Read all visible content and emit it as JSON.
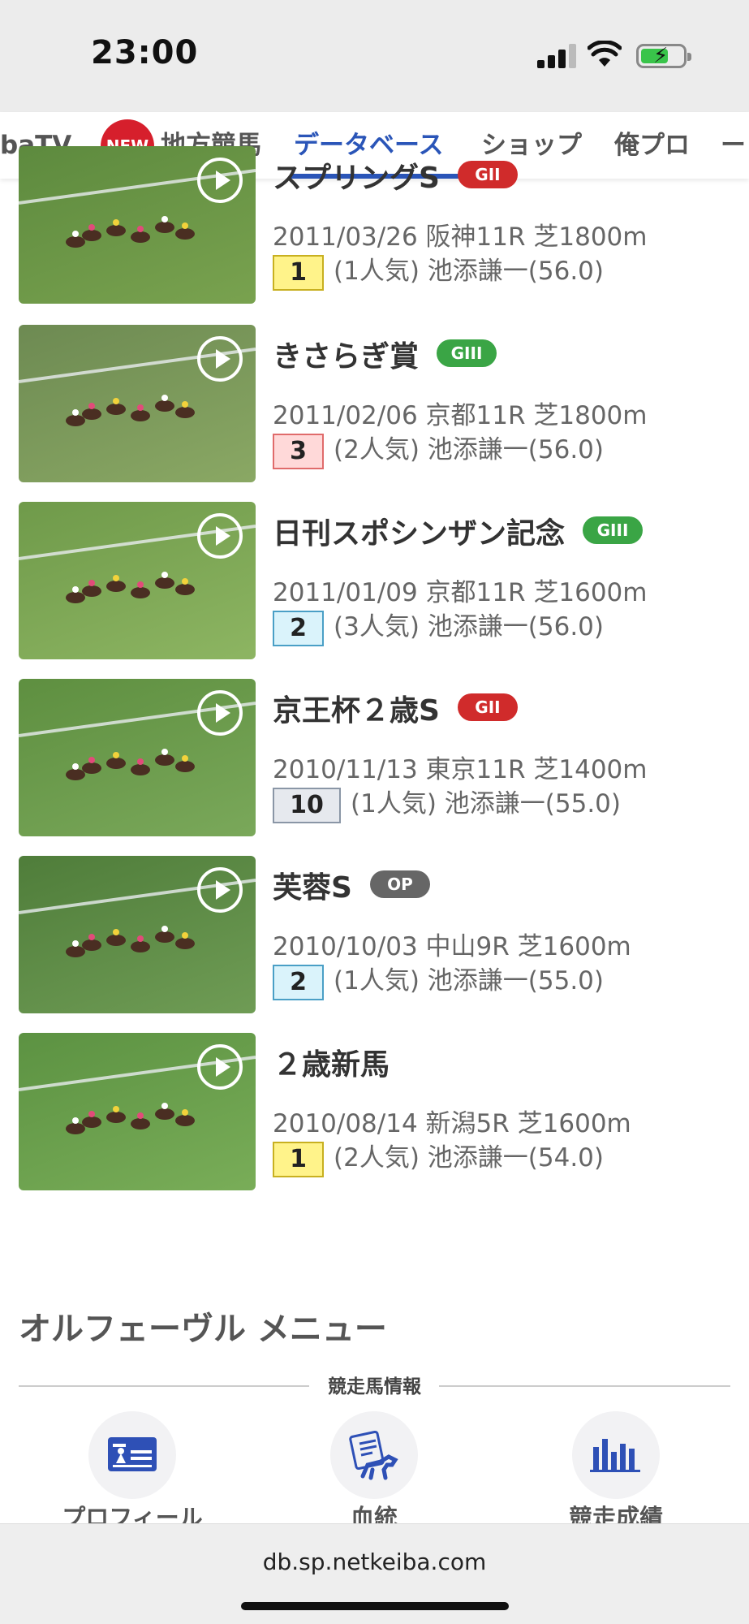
{
  "status_bar": {
    "time": "23:00"
  },
  "nav": {
    "tabs": [
      {
        "label": "baTV"
      },
      {
        "label": "地方競馬",
        "badge": "NEW"
      },
      {
        "label": "データベース",
        "active": true
      },
      {
        "label": "ショップ"
      },
      {
        "label": "俺プロ"
      },
      {
        "label": "ー"
      }
    ]
  },
  "races": [
    {
      "name": "スプリングS",
      "grade": "GII",
      "grade_color": "#d02b2b",
      "info": "2011/03/26 阪神11R 芝1800m",
      "rank": "1",
      "rank_bg": "#fff38a",
      "rank_border": "#c8b020",
      "popularity": "(1人気)",
      "jockey": "池添謙一(56.0)"
    },
    {
      "name": "きさらぎ賞",
      "grade": "GIII",
      "grade_color": "#3aa545",
      "info": "2011/02/06 京都11R 芝1800m",
      "rank": "3",
      "rank_bg": "#ffd9d9",
      "rank_border": "#e06b6b",
      "popularity": "(2人気)",
      "jockey": "池添謙一(56.0)"
    },
    {
      "name": "日刊スポシンザン記念",
      "grade": "GIII",
      "grade_color": "#3aa545",
      "info": "2011/01/09 京都11R 芝1600m",
      "rank": "2",
      "rank_bg": "#daf3fb",
      "rank_border": "#4a9fc6",
      "popularity": "(3人気)",
      "jockey": "池添謙一(56.0)"
    },
    {
      "name": "京王杯２歳S",
      "grade": "GII",
      "grade_color": "#d02b2b",
      "info": "2010/11/13 東京11R 芝1400m",
      "rank": "10",
      "rank_bg": "#e6e9ee",
      "rank_border": "#8a96a6",
      "popularity": "(1人気)",
      "jockey": "池添謙一(55.0)"
    },
    {
      "name": "芙蓉S",
      "grade": "OP",
      "grade_color": "#666666",
      "info": "2010/10/03 中山9R 芝1600m",
      "rank": "2",
      "rank_bg": "#daf3fb",
      "rank_border": "#4a9fc6",
      "popularity": "(1人気)",
      "jockey": "池添謙一(55.0)"
    },
    {
      "name": "２歳新馬",
      "grade": "",
      "grade_color": "",
      "info": "2010/08/14 新潟5R 芝1600m",
      "rank": "1",
      "rank_bg": "#fff38a",
      "rank_border": "#c8b020",
      "popularity": "(2人気)",
      "jockey": "池添謙一(54.0)"
    }
  ],
  "menu": {
    "title": "オルフェーヴル メニュー",
    "section_label": "競走馬情報",
    "items": [
      {
        "label": "プロフィール",
        "icon": "profile-card-icon"
      },
      {
        "label": "血統",
        "icon": "pedigree-horse-icon"
      },
      {
        "label": "競走成績",
        "icon": "bar-chart-icon"
      }
    ]
  },
  "browser": {
    "url": "db.sp.netkeiba.com"
  },
  "colors": {
    "accent": "#2a55b8",
    "new_badge": "#d61f2c"
  }
}
